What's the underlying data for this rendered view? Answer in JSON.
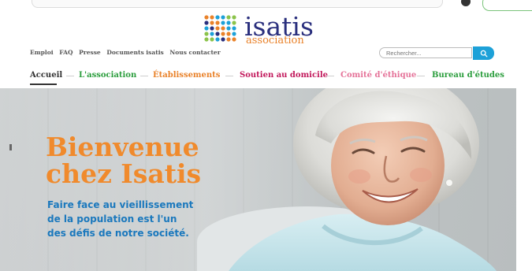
{
  "logo": {
    "name": "isatis",
    "sub": "association",
    "dot_colors": [
      "#e9822a",
      "#1da1d8",
      "#8bc34a",
      "#e9822a",
      "#2a2f7d"
    ]
  },
  "top_links": [
    "Emploi",
    "FAQ",
    "Presse",
    "Documents isatis",
    "Nous contacter"
  ],
  "search": {
    "placeholder": "Rechercher..."
  },
  "nav": {
    "items": [
      {
        "label": "Accueil",
        "color": "#333333"
      },
      {
        "label": "L'association",
        "color": "#2a9d3c"
      },
      {
        "label": "Établissements",
        "color": "#e9822a"
      },
      {
        "label": "Soutien au domicile",
        "color": "#c2185b"
      },
      {
        "label": "Comité d'éthique",
        "color": "#e57399"
      },
      {
        "label": "Bureau d'études",
        "color": "#2a9d3c"
      }
    ]
  },
  "hero": {
    "title_line1": "Bienvenue",
    "title_line2": "chez Isatis",
    "subtitle_line1": "Faire face au vieillissement",
    "subtitle_line2": "de la population est l'un",
    "subtitle_line3": "des défis de notre société."
  },
  "colors": {
    "brand_navy": "#2a2f7d",
    "brand_orange": "#f08a2c",
    "brand_blue": "#1a78bd",
    "search_button": "#1da1d8"
  }
}
